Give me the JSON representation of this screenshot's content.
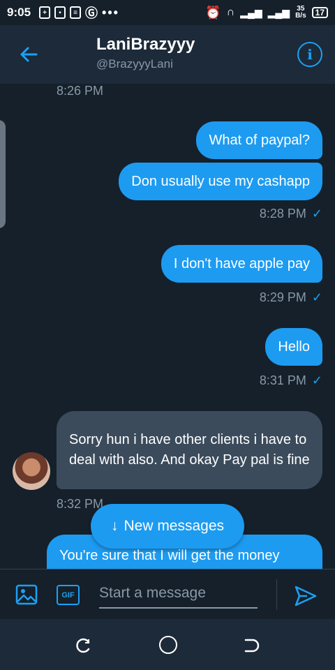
{
  "status_bar": {
    "time": "9:05",
    "dots": "•••",
    "net_speed_value": "35",
    "net_speed_unit": "B/s",
    "battery": "17"
  },
  "header": {
    "title": "LaniBrazyyy",
    "handle": "@BrazyyyLani",
    "info_glyph": "i"
  },
  "chat": {
    "timestamps": [
      "8:26 PM",
      "8:28 PM",
      "8:29 PM",
      "8:31 PM",
      "8:32 PM"
    ],
    "check_glyph": "✓",
    "messages": [
      {
        "from": "me",
        "text": "What of paypal?"
      },
      {
        "from": "me",
        "text": "Don usually use my cashapp"
      },
      {
        "from": "me",
        "text": "I don't have apple pay"
      },
      {
        "from": "me",
        "text": "Hello"
      },
      {
        "from": "them",
        "text": "Sorry hun i have other clients i have to deal with also. And okay Pay pal is fine"
      },
      {
        "from": "me",
        "text": "You're sure that I will get the money"
      }
    ],
    "new_messages_label": "New messages",
    "new_messages_arrow": "↓"
  },
  "composer": {
    "placeholder": "Start a message",
    "gif_label": "GIF"
  },
  "colors": {
    "accent": "#1d9bf0",
    "background": "#15202b",
    "header_bg": "#1c2a39",
    "received_bubble": "#3b4b5b",
    "muted_text": "#8899a6"
  },
  "icons": {
    "back": "arrow-left-icon",
    "info": "info-icon",
    "image": "image-icon",
    "gif": "gif-icon",
    "send": "send-icon",
    "nav_recent": "recent-apps-icon",
    "nav_home": "home-icon",
    "nav_back": "back-icon"
  }
}
